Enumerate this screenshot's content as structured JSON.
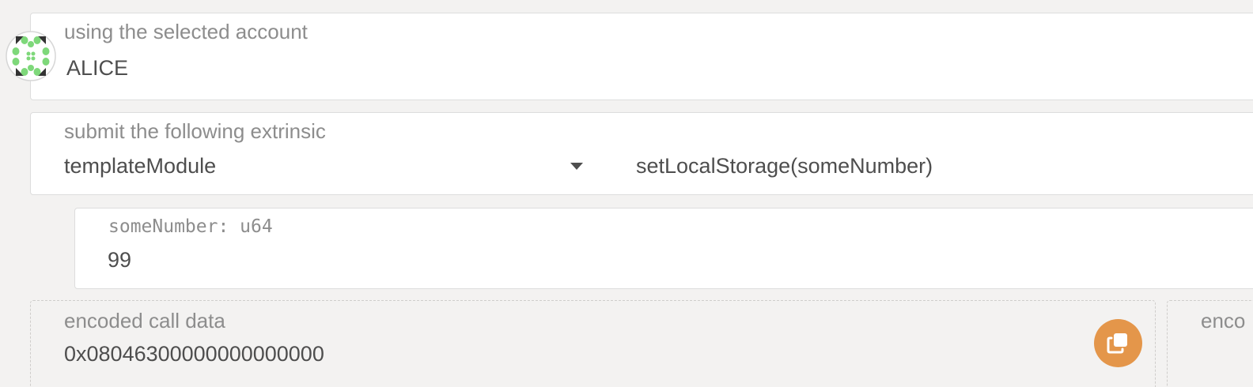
{
  "account": {
    "label": "using the selected account",
    "name": "ALICE",
    "identicon": "polkadot-identicon"
  },
  "extrinsic": {
    "label": "submit the following extrinsic",
    "section": "templateModule",
    "method": "setLocalStorage(someNumber)"
  },
  "param": {
    "label": "someNumber: u64",
    "value": "99"
  },
  "encoded": {
    "call_data_label": "encoded call data",
    "call_data": "0x08046300000000000000",
    "copy_icon": "copy-icon",
    "call_hash_label": "enco"
  },
  "colors": {
    "background": "#f3f2f1",
    "accent": "#e4964a",
    "identicon_green": "#7ed87a"
  }
}
